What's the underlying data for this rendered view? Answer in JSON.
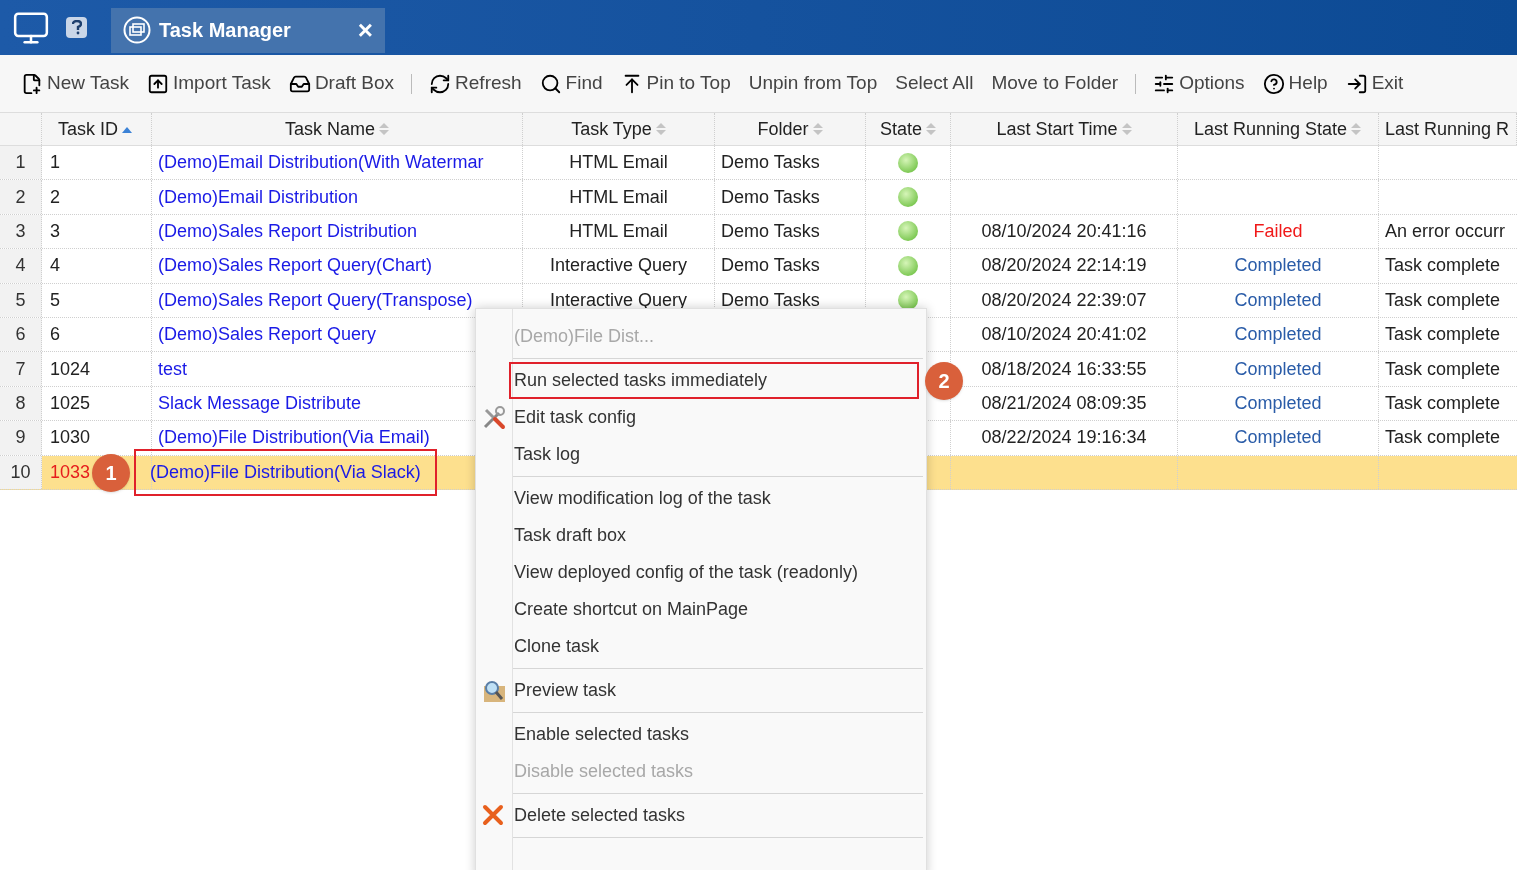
{
  "header": {
    "tab": {
      "title": "Task Manager",
      "close": "×"
    }
  },
  "toolbar": [
    [
      {
        "label": "New Task",
        "kind": "new"
      },
      {
        "label": "Import Task",
        "kind": "import"
      },
      {
        "label": "Draft Box",
        "kind": "draft"
      }
    ],
    [
      {
        "label": "Refresh",
        "kind": "refresh"
      },
      {
        "label": "Find",
        "kind": "find"
      },
      {
        "label": "Pin to Top",
        "kind": "pin"
      },
      {
        "label": "Unpin from Top",
        "kind": "plain"
      },
      {
        "label": "Select All",
        "kind": "plain"
      },
      {
        "label": "Move to Folder",
        "kind": "plain"
      }
    ],
    [
      {
        "label": "Options",
        "kind": "options"
      },
      {
        "label": "Help",
        "kind": "help"
      },
      {
        "label": "Exit",
        "kind": "exit"
      }
    ]
  ],
  "table": {
    "columns": [
      {
        "label": "Task ID",
        "sortable": true,
        "sorted": true
      },
      {
        "label": "Task Name",
        "sortable": true,
        "sorted": false
      },
      {
        "label": "Task Type",
        "sortable": true,
        "sorted": false
      },
      {
        "label": "Folder",
        "sortable": true,
        "sorted": false
      },
      {
        "label": "State",
        "sortable": true,
        "sorted": false
      },
      {
        "label": "Last Start Time",
        "sortable": true,
        "sorted": false
      },
      {
        "label": "Last Running State",
        "sortable": true,
        "sorted": false
      },
      {
        "label": "Last Running R"
      }
    ],
    "rows": [
      {
        "num": "1",
        "id": "1",
        "name": "(Demo)Email Distribution(With Watermar",
        "type": "HTML Email",
        "folder": "Demo Tasks",
        "enabled": true,
        "selected": false
      },
      {
        "num": "2",
        "id": "2",
        "name": "(Demo)Email Distribution",
        "type": "HTML Email",
        "folder": "Demo Tasks",
        "enabled": true,
        "selected": false
      },
      {
        "num": "3",
        "id": "3",
        "name": "(Demo)Sales Report Distribution",
        "type": "HTML Email",
        "folder": "Demo Tasks",
        "enabled": true,
        "start": "08/10/2024 20:41:16",
        "status": {
          "text": "Failed",
          "kind": "failed"
        },
        "result": "An error occurr",
        "selected": false
      },
      {
        "num": "4",
        "id": "4",
        "name": "(Demo)Sales Report Query(Chart)",
        "type": "Interactive Query",
        "folder": "Demo Tasks",
        "enabled": true,
        "start": "08/20/2024 22:14:19",
        "status": {
          "text": "Completed",
          "kind": "completed"
        },
        "result": "Task complete",
        "selected": false
      },
      {
        "num": "5",
        "id": "5",
        "name": "(Demo)Sales Report Query(Transpose)",
        "type": "Interactive Query",
        "folder": "Demo Tasks",
        "enabled": true,
        "start": "08/20/2024 22:39:07",
        "status": {
          "text": "Completed",
          "kind": "completed"
        },
        "result": "Task complete",
        "selected": false
      },
      {
        "num": "6",
        "id": "6",
        "name": "(Demo)Sales Report Query",
        "start": "08/10/2024 20:41:02",
        "status": {
          "text": "Completed",
          "kind": "completed"
        },
        "result": "Task complete",
        "selected": false
      },
      {
        "num": "7",
        "id": "1024",
        "name": "test",
        "start": "08/18/2024 16:33:55",
        "status": {
          "text": "Completed",
          "kind": "completed"
        },
        "result": "Task complete",
        "selected": false
      },
      {
        "num": "8",
        "id": "1025",
        "name": "Slack Message Distribute",
        "start": "08/21/2024 08:09:35",
        "status": {
          "text": "Completed",
          "kind": "completed"
        },
        "result": "Task complete",
        "selected": false
      },
      {
        "num": "9",
        "id": "1030",
        "name": "(Demo)File Distribution(Via Email)",
        "start": "08/22/2024 19:16:34",
        "status": {
          "text": "Completed",
          "kind": "completed"
        },
        "result": "Task complete",
        "selected": false
      },
      {
        "num": "10",
        "id": "1033",
        "name": "(Demo)File Distribution(Via Slack)",
        "selected": true,
        "callout": "1"
      }
    ]
  },
  "context_menu": {
    "groups": [
      [
        {
          "label": "(Demo)File Dist...",
          "kind": "plain",
          "disabled": true
        }
      ],
      [
        {
          "label": "Run selected tasks immediately",
          "kind": "plain",
          "disabled": false,
          "callout": "2"
        },
        {
          "label": "Edit task config",
          "kind": "edit",
          "disabled": false
        },
        {
          "label": "Task log",
          "kind": "plain",
          "disabled": false
        }
      ],
      [
        {
          "label": "View modification log of the task",
          "kind": "plain",
          "disabled": false
        },
        {
          "label": "Task draft box",
          "kind": "plain",
          "disabled": false
        },
        {
          "label": "View deployed config of the task (readonly)",
          "kind": "plain",
          "disabled": false
        },
        {
          "label": "Create shortcut on MainPage",
          "kind": "plain",
          "disabled": false
        },
        {
          "label": "Clone task",
          "kind": "plain",
          "disabled": false
        }
      ],
      [
        {
          "label": "Preview task",
          "kind": "preview",
          "disabled": false
        }
      ],
      [
        {
          "label": "Enable selected tasks",
          "kind": "plain",
          "disabled": false
        },
        {
          "label": "Disable selected tasks",
          "kind": "plain",
          "disabled": true
        }
      ],
      [
        {
          "label": "Delete selected tasks",
          "kind": "delete",
          "disabled": false
        }
      ]
    ]
  }
}
